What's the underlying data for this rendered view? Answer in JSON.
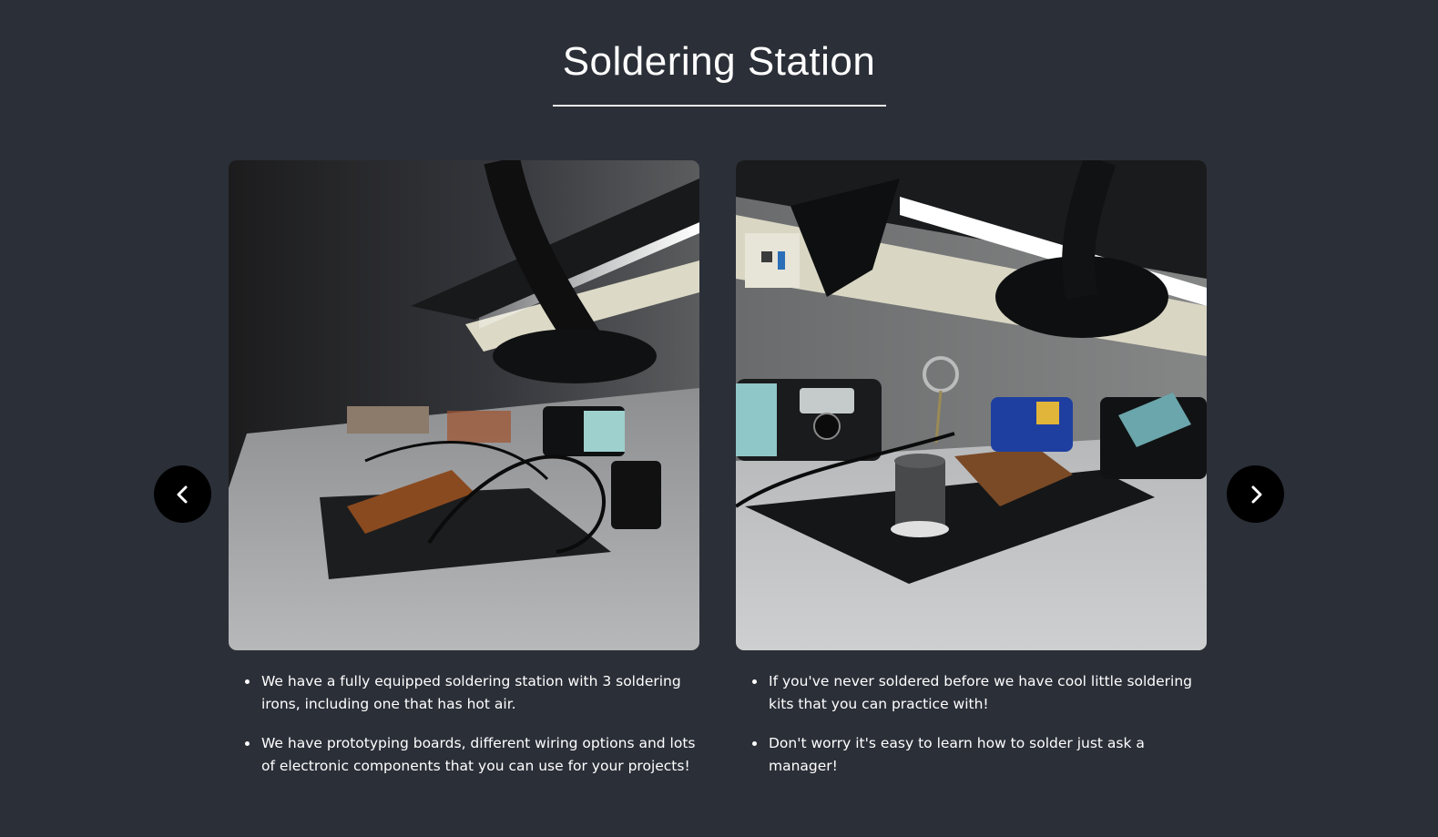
{
  "page": {
    "title": "Soldering Station",
    "background": "#2b2f38"
  },
  "carousel": {
    "prev_icon": "chevron-left-icon",
    "next_icon": "chevron-right-icon",
    "slides": [
      {
        "image_label": "soldering-bench-photo-1",
        "bullets": [
          "We have a fully equipped soldering station with 3 soldering irons, including one that has hot air.",
          "We have prototyping boards, different wiring options and lots of electronic components that you can use for your projects!"
        ]
      },
      {
        "image_label": "soldering-bench-photo-2",
        "bullets": [
          "If you've never soldered before we have cool little soldering kits that you can practice with!",
          "Don't worry it's easy to learn how to solder just ask a manager!"
        ]
      }
    ]
  }
}
